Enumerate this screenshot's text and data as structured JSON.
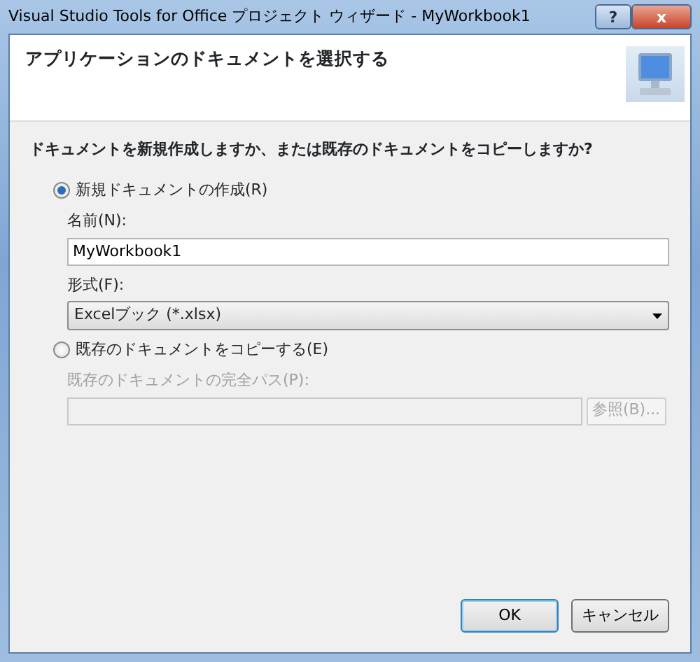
{
  "window": {
    "title": "Visual Studio Tools for Office プロジェクト ウィザード - MyWorkbook1",
    "help_button": "?",
    "close_button": "x"
  },
  "header": {
    "title": "アプリケーションのドキュメントを選択する"
  },
  "question": "ドキュメントを新規作成しますか、または既存のドキュメントをコピーしますか?",
  "options": [
    {
      "label": "新規ドキュメントの作成(R)",
      "selected": true,
      "fields": [
        {
          "kind": "input",
          "label": "名前(N):",
          "value": "MyWorkbook1",
          "disabled": false
        },
        {
          "kind": "select",
          "label": "形式(F):",
          "value": "Excelブック (*.xlsx)",
          "disabled": false
        }
      ]
    },
    {
      "label": "既存のドキュメントをコピーする(E)",
      "selected": false,
      "fields": [
        {
          "kind": "browse",
          "label": "既存のドキュメントの完全パス(P):",
          "button": "参照(B)...",
          "disabled": true
        }
      ]
    }
  ],
  "buttons": [
    {
      "label": "OK",
      "default": true
    },
    {
      "label": "キャンセル",
      "default": false
    }
  ]
}
